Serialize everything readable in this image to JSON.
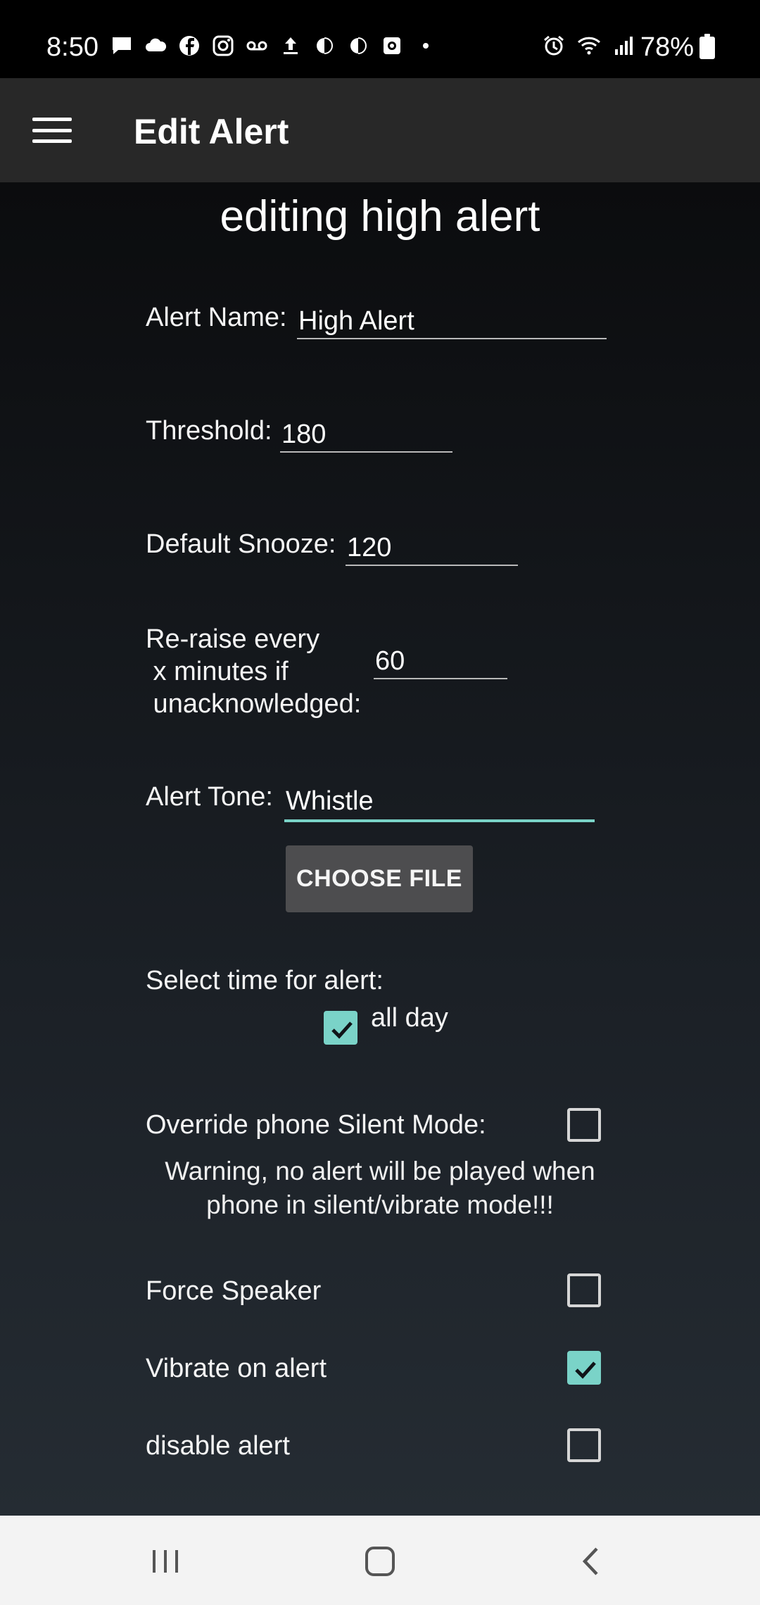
{
  "status_bar": {
    "time": "8:50",
    "battery_percent": "78%",
    "left_icons": [
      "message-icon",
      "cloud-icon",
      "facebook-icon",
      "instagram-icon",
      "voicemail-icon",
      "upload-icon",
      "contrast-icon",
      "contrast-icon",
      "camera-icon",
      "dot-icon"
    ],
    "right_icons": [
      "alarm-icon",
      "wifi-icon",
      "signal-icon"
    ]
  },
  "app_bar": {
    "title": "Edit Alert"
  },
  "page": {
    "heading": "editing high alert"
  },
  "form": {
    "alert_name_label": "Alert Name:",
    "alert_name_value": "High Alert",
    "threshold_label": "Threshold:",
    "threshold_value": "180",
    "default_snooze_label": "Default Snooze:",
    "default_snooze_value": "120",
    "reraise_label_line1": "Re-raise every",
    "reraise_label_line2": " x minutes if",
    "reraise_label_line3": " unacknowledged:",
    "reraise_value": "60",
    "alert_tone_label": "Alert Tone:",
    "alert_tone_value": "Whistle",
    "choose_file_label": "CHOOSE FILE",
    "select_time_label": "Select time for alert:",
    "all_day_label": "all day",
    "all_day_checked": true,
    "override_silent_label": "Override phone Silent Mode:",
    "override_silent_checked": false,
    "warning_line1": "Warning, no alert will be played when",
    "warning_line2": "phone in silent/vibrate mode!!!",
    "force_speaker_label": "Force Speaker",
    "force_speaker_checked": false,
    "vibrate_label": "Vibrate on alert",
    "vibrate_checked": true,
    "disable_label": "disable alert",
    "disable_checked": false
  },
  "colors": {
    "accent": "#7ad3c8",
    "app_bar": "#282828",
    "button": "#4d4d4f"
  },
  "nav_bar": {
    "buttons": [
      "recent-apps-icon",
      "home-icon",
      "back-icon"
    ]
  }
}
